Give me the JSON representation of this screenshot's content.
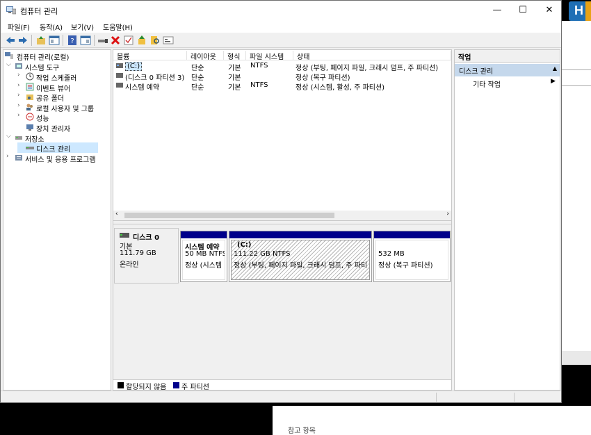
{
  "window": {
    "title": "컴퓨터 관리",
    "min": "—",
    "max": "☐",
    "close": "✕"
  },
  "menu": [
    "파일(F)",
    "동작(A)",
    "보기(V)",
    "도움말(H)"
  ],
  "toolbar": [
    "back-icon",
    "forward-icon",
    "up-folder-icon",
    "show-tree-icon",
    "help-icon",
    "console-icon",
    "connect-icon",
    "delete-icon",
    "check-icon",
    "export-icon",
    "search-icon",
    "properties-icon"
  ],
  "tree": {
    "root": "컴퓨터 관리(로컬)",
    "system_tools": "시스템 도구",
    "task_scheduler": "작업 스케줄러",
    "event_viewer": "이벤트 뷰어",
    "shared_folders": "공유 폴더",
    "local_users": "로컬 사용자 및 그룹",
    "performance": "성능",
    "device_manager": "장치 관리자",
    "storage": "저장소",
    "disk_management": "디스크 관리",
    "services": "서비스 및 응용 프로그램"
  },
  "volume_list": {
    "headers": [
      "볼륨",
      "레이아웃",
      "형식",
      "파일 시스템",
      "상태"
    ],
    "rows": [
      {
        "name": "(C:)",
        "layout": "단순",
        "type": "기본",
        "fs": "NTFS",
        "status": "정상 (부팅, 페이지 파일, 크래시 덤프, 주 파티션)"
      },
      {
        "name": "(디스크 0 파티션 3)",
        "layout": "단순",
        "type": "기본",
        "fs": "",
        "status": "정상 (복구 파티션)"
      },
      {
        "name": "시스템 예약",
        "layout": "단순",
        "type": "기본",
        "fs": "NTFS",
        "status": "정상 (시스템, 활성, 주 파티션)"
      }
    ]
  },
  "disk": {
    "name": "디스크 0",
    "type": "기본",
    "size": "111.79 GB",
    "state": "온라인",
    "partitions": [
      {
        "title": "시스템 예약",
        "size": "50 MB NTFS",
        "status": "정상 (시스템"
      },
      {
        "title": "(C:)",
        "size": "111.22 GB NTFS",
        "status": "정상 (부팅, 페이지 파일, 크래시 덤프, 주 파티"
      },
      {
        "title": "",
        "size": "532 MB",
        "status": "정상 (복구 파티션)"
      }
    ]
  },
  "legend": {
    "unallocated": "할당되지 않음",
    "primary": "주 파티션",
    "unallocated_color": "#000000",
    "primary_color": "#00008b"
  },
  "actions": {
    "header": "작업",
    "section": "디스크 관리",
    "more": "기타 작업"
  },
  "background": {
    "caption": "참고 항목"
  }
}
